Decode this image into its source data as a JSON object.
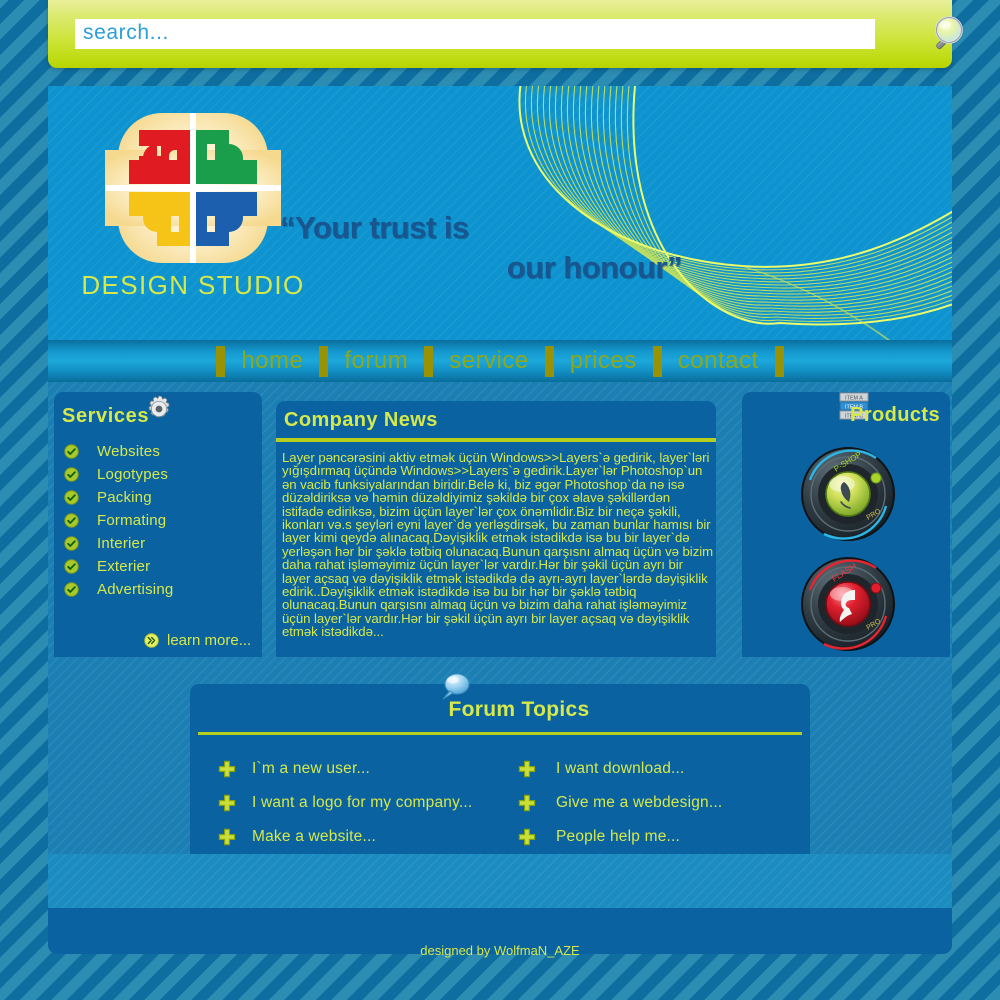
{
  "search": {
    "placeholder": "search...",
    "value": "",
    "icon": "magnifier-icon"
  },
  "brand": {
    "logo_text": "DESIGN STUDIO",
    "tagline_line1": "“Your trust is",
    "tagline_line2": "our honour”",
    "logo_colors": {
      "red": "#e01b22",
      "green": "#1a9e4b",
      "yellow": "#f6c417",
      "blue": "#1b5fae",
      "halo": "#f7e2a8"
    }
  },
  "nav": {
    "items": [
      {
        "label": "home"
      },
      {
        "label": "forum"
      },
      {
        "label": "service"
      },
      {
        "label": "prices"
      },
      {
        "label": "contact"
      }
    ]
  },
  "services": {
    "title": "Services",
    "icon": "gear-icon",
    "items": [
      {
        "label": "Websites"
      },
      {
        "label": "Logotypes"
      },
      {
        "label": "Packing"
      },
      {
        "label": "Formating"
      },
      {
        "label": "Interier"
      },
      {
        "label": "Exterier"
      },
      {
        "label": "Advertising"
      }
    ],
    "learn_more": "learn more...",
    "learn_more_icon": "double-chevron-right-icon"
  },
  "news": {
    "title": "Company News",
    "body": "Layer pəncərəsini aktiv etmək üçün Windows>>Layers`ə gedirik, layer`ləri yığışdırmaq üçündə Windows>>Layers`ə gedirik.Layer`lər Photoshop`un ən vacib funksiyalarından biridir.Belə ki, biz əgər Photoshop`da nə isə düzəldiriksə və həmin düzəldiyimiz şəkildə bir çox əlavə şəkillərdən istifadə ediriksə, bizim üçün layer`lər çox önəmlidir.Biz bir neçə şəkili, ikonları və.s şeyləri eyni layer`də yerləşdirsək, bu zaman bunlar hamısı bir layer kimi qeydə alınacaq.Dəyişiklik etmək istədikdə isə bu bir layer`də yerləşən hər bir şəklə tətbiq olunacaq.Bunun qarşısnı almaq üçün və bizim daha rahat işləməyimiz üçün layer`lər vardır.Hər bir şəkil üçün ayrı bir layer açsaq və dəyişiklik etmək istədikdə də ayrı-ayrı layer`lərdə dəyişiklik edirik..Dəyişiklik etmək istədikdə isə bu bir hər bir şəklə tətbiq olunacaq.Bunun qarşısnı almaq üçün və bizim daha rahat işləməyimiz üçün layer`lər vardır.Hər bir şəkil üçün ayrı bir layer açsaq və dəyişiklik etmək istədikdə..."
  },
  "products": {
    "title": "Products",
    "icon": "list-items-icon",
    "icon_rows": [
      "ITEM A",
      "ITEM B",
      "ITEM C"
    ],
    "items": [
      {
        "name": "photoshop-badge",
        "accent": "#8fbe2a"
      },
      {
        "name": "flash-badge",
        "accent": "#cc1a2b"
      }
    ]
  },
  "forum": {
    "title": "Forum Topics",
    "icon": "speech-bubble-icon",
    "topics": [
      {
        "label": "I`m a new user..."
      },
      {
        "label": "I want download..."
      },
      {
        "label": "I want a logo for my company..."
      },
      {
        "label": "Give me a webdesign..."
      },
      {
        "label": "Make a website..."
      },
      {
        "label": "People help me..."
      }
    ]
  },
  "footer": {
    "credit": "designed by WolfmaN_AZE"
  },
  "theme": {
    "lime": "#d6e84a",
    "lime_bar": "#b6cf1e",
    "panel_blue": "#0a63a0",
    "banner_blue": "#0d93cf",
    "bg_stripe_light": "#2d8cb2",
    "bg_stripe_dark": "#0f6ea0"
  }
}
